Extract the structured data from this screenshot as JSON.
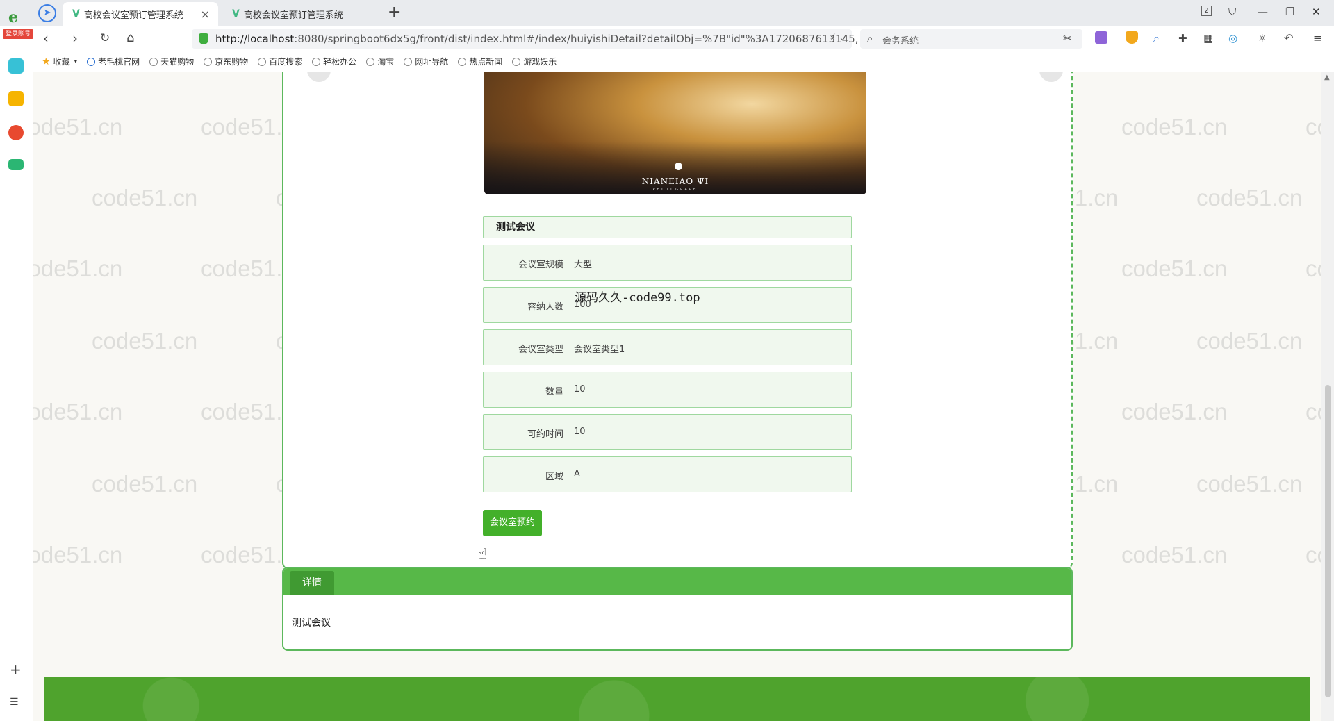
{
  "browser": {
    "tabs": [
      {
        "title": "高校会议室预订管理系统",
        "active": true
      },
      {
        "title": "高校会议室预订管理系统",
        "active": false
      }
    ],
    "tab_close": "×",
    "new_tab": "+",
    "url_host": "http://localhost",
    "url_rest": ":8080/springboot6dx5g/front/dist/index.html#/index/huiyishiDetail?detailObj=%7B\"id\"%3A1720687613145,",
    "search_placeholder": "会务系统",
    "login_badge": "登录账号",
    "page_count_badge": "2",
    "bookmarks": [
      "收藏",
      "老毛桃官网",
      "天猫购物",
      "京东购物",
      "百度搜索",
      "轻松办公",
      "淘宝",
      "网址导航",
      "热点新闻",
      "游戏娱乐"
    ]
  },
  "detail": {
    "room_name": "测试会议",
    "carousel_brand": "NIANEIAO ΨI",
    "carousel_brand_sub": "PHOTOGRAPH",
    "fields": [
      {
        "label": "会议室规模",
        "value": "大型"
      },
      {
        "label": "容纳人数",
        "value": "100"
      },
      {
        "label": "会议室类型",
        "value": "会议室类型1"
      },
      {
        "label": "数量",
        "value": "10"
      },
      {
        "label": "可约时间",
        "value": "10"
      },
      {
        "label": "区域",
        "value": "A"
      }
    ],
    "book_button": "会议室预约",
    "overlay_text": "源码久久-code99.top"
  },
  "tabs": {
    "detail_tab": "详情",
    "content": "测试会议"
  },
  "watermark": "code51.cn",
  "colors": {
    "accent": "#43b02a",
    "field_border": "#9fd89f",
    "field_bg": "#f0f8ee"
  }
}
